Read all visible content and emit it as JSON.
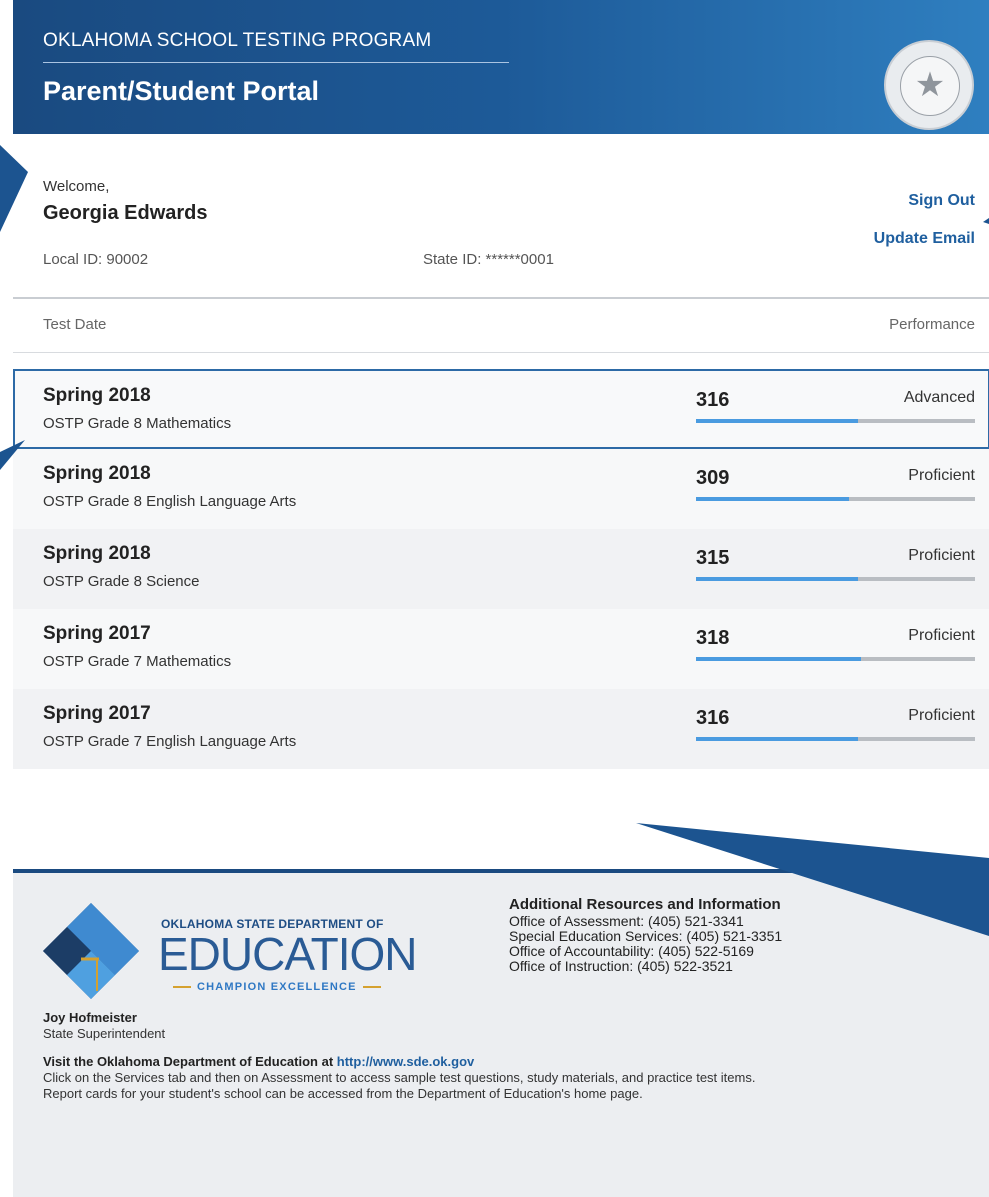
{
  "header": {
    "program": "OKLAHOMA SCHOOL TESTING PROGRAM",
    "portal_title": "Parent/Student Portal"
  },
  "user": {
    "welcome": "Welcome,",
    "name": "Georgia Edwards",
    "local_id": "Local ID: 90002",
    "state_id": "State ID: ******0001",
    "sign_out": "Sign Out",
    "update_email": "Update Email"
  },
  "table": {
    "col_date": "Test Date",
    "col_performance": "Performance",
    "rows": [
      {
        "season": "Spring 2018",
        "test": "OSTP Grade 8 Mathematics",
        "score": "316",
        "level": "Advanced",
        "progress": 0.58
      },
      {
        "season": "Spring 2018",
        "test": "OSTP Grade 8 English Language Arts",
        "score": "309",
        "level": "Proficient",
        "progress": 0.55
      },
      {
        "season": "Spring 2018",
        "test": "OSTP Grade 8 Science",
        "score": "315",
        "level": "Proficient",
        "progress": 0.58
      },
      {
        "season": "Spring 2017",
        "test": "OSTP Grade 7 Mathematics",
        "score": "318",
        "level": "Proficient",
        "progress": 0.59
      },
      {
        "season": "Spring 2017",
        "test": "OSTP Grade 7 English Language Arts",
        "score": "316",
        "level": "Proficient",
        "progress": 0.58
      }
    ]
  },
  "footer": {
    "logo_title": "OKLAHOMA STATE DEPARTMENT OF",
    "logo_main": "EDUCATION",
    "logo_sub": "CHAMPION EXCELLENCE",
    "resources_title": "Additional Resources and Information",
    "resources": [
      "Office of Assessment: (405) 521-3341",
      "Special Education Services: (405) 521-3351",
      "Office of Accountability: (405) 522-5169",
      "Office of Instruction: (405) 522-3521"
    ],
    "superintendent_name": "Joy Hofmeister",
    "superintendent_title": "State Superintendent",
    "visit_text": "Visit the Oklahoma Department of Education at",
    "visit_url": "http://www.sde.ok.gov",
    "note1": "Click on the Services tab and then on Assessment to access sample test questions, study materials, and practice test items.",
    "note2": "Report cards for your student's school can be accessed from the Department of Education's home page."
  },
  "colors": {
    "header_dark": "#1a4a80",
    "header_light": "#2f7fc0",
    "link": "#1f5f9f",
    "progress_fill": "#4a9be0",
    "progress_track": "#b9bdc2",
    "callout": "#1c5490"
  },
  "icons": {
    "seal": "state-seal-icon",
    "logo": "osde-diamond-logo-icon"
  }
}
